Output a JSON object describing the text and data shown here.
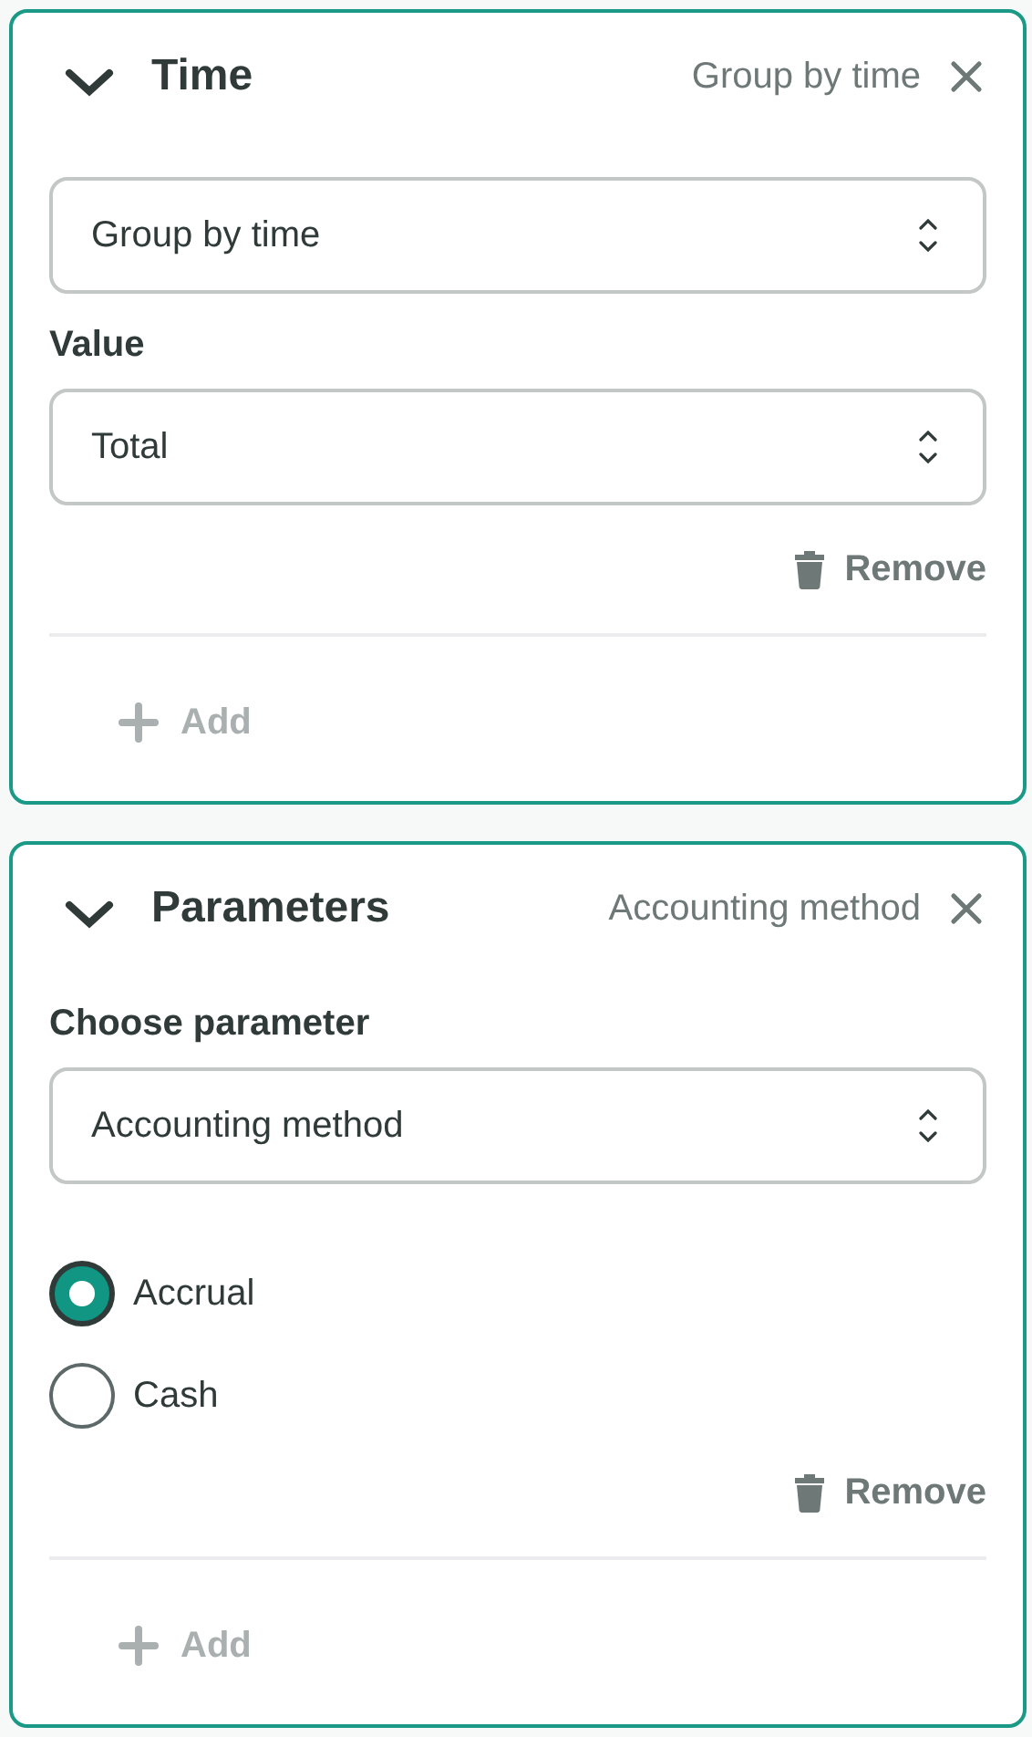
{
  "panels": [
    {
      "title": "Time",
      "summary": "Group by time",
      "expanded": true,
      "fields": [
        {
          "kind": "select",
          "value": "Group by time"
        },
        {
          "kind": "select",
          "label": "Value",
          "value": "Total"
        }
      ],
      "remove": "Remove",
      "add": {
        "label": "Add",
        "disabled": true
      }
    },
    {
      "title": "Parameters",
      "summary": "Accounting method",
      "expanded": true,
      "fields": [
        {
          "kind": "select",
          "label": "Choose parameter",
          "value": "Accounting method"
        },
        {
          "kind": "radio",
          "options": [
            {
              "label": "Accrual",
              "selected": true
            },
            {
              "label": "Cash",
              "selected": false
            }
          ]
        }
      ],
      "remove": "Remove",
      "add": {
        "label": "Add",
        "disabled": true
      }
    }
  ]
}
